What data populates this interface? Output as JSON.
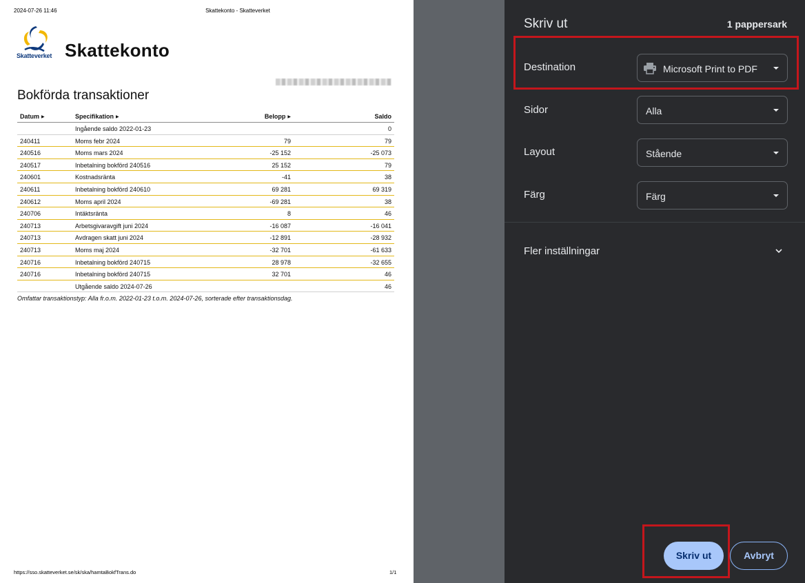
{
  "preview": {
    "header_date": "2024-07-26 11:46",
    "header_title": "Skattekonto - Skatteverket",
    "logo_text": "Skatteverket",
    "brand_title": "Skattekonto",
    "section_title": "Bokförda transaktioner",
    "table": {
      "headers": {
        "date": "Datum",
        "spec": "Specifikation",
        "amount": "Belopp",
        "balance": "Saldo"
      },
      "rows": [
        {
          "date": "",
          "spec": "Ingående saldo 2022-01-23",
          "amount": "",
          "balance": "0"
        },
        {
          "date": "240411",
          "spec": "Moms febr 2024",
          "amount": "79",
          "balance": "79"
        },
        {
          "date": "240516",
          "spec": "Moms mars 2024",
          "amount": "-25 152",
          "balance": "-25 073"
        },
        {
          "date": "240517",
          "spec": "Inbetalning bokförd 240516",
          "amount": "25 152",
          "balance": "79"
        },
        {
          "date": "240601",
          "spec": "Kostnadsränta",
          "amount": "-41",
          "balance": "38"
        },
        {
          "date": "240611",
          "spec": "Inbetalning bokförd 240610",
          "amount": "69 281",
          "balance": "69 319"
        },
        {
          "date": "240612",
          "spec": "Moms april 2024",
          "amount": "-69 281",
          "balance": "38"
        },
        {
          "date": "240706",
          "spec": "Intäktsränta",
          "amount": "8",
          "balance": "46"
        },
        {
          "date": "240713",
          "spec": "Arbetsgivaravgift juni 2024",
          "amount": "-16 087",
          "balance": "-16 041"
        },
        {
          "date": "240713",
          "spec": "Avdragen skatt juni 2024",
          "amount": "-12 891",
          "balance": "-28 932"
        },
        {
          "date": "240713",
          "spec": "Moms maj 2024",
          "amount": "-32 701",
          "balance": "-61 633"
        },
        {
          "date": "240716",
          "spec": "Inbetalning bokförd 240715",
          "amount": "28 978",
          "balance": "-32 655"
        },
        {
          "date": "240716",
          "spec": "Inbetalning bokförd 240715",
          "amount": "32 701",
          "balance": "46"
        },
        {
          "date": "",
          "spec": "Utgående saldo 2024-07-26",
          "amount": "",
          "balance": "46"
        }
      ]
    },
    "footnote": "Omfattar transaktionstyp: Alla fr.o.m. 2022-01-23 t.o.m. 2024-07-26, sorterade efter transaktionsdag.",
    "footer_url": "https://sso.skatteverket.se/sk/ska/hamtaBokfTrans.do",
    "footer_page": "1/1"
  },
  "dialog": {
    "title": "Skriv ut",
    "sheet_count": "1 pappersark",
    "destination": {
      "label": "Destination",
      "value": "Microsoft Print to PDF",
      "icon": "printer-icon"
    },
    "pages": {
      "label": "Sidor",
      "value": "Alla"
    },
    "layout": {
      "label": "Layout",
      "value": "Stående"
    },
    "color": {
      "label": "Färg",
      "value": "Färg"
    },
    "more_settings": "Fler inställningar",
    "print_button": "Skriv ut",
    "cancel_button": "Avbryt"
  },
  "colors": {
    "dialog_bg": "#292a2d",
    "primary_button": "#a8c7fa",
    "highlight": "#c4161c",
    "row_separator": "#e3b818"
  }
}
